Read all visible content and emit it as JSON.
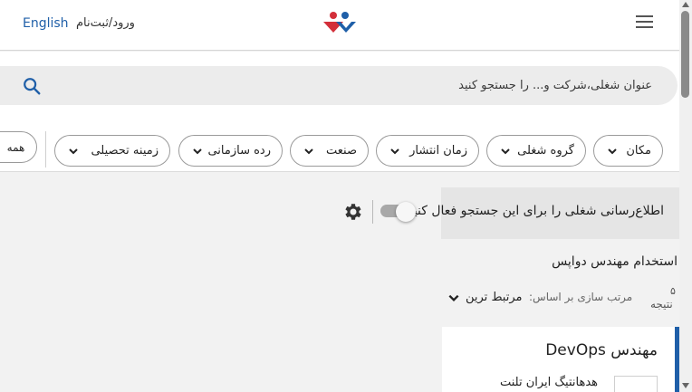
{
  "header": {
    "english_label": "English",
    "login_label": "ورود/ثبت‌نام",
    "logo_icon": "jobinja-logo-icon",
    "menu_icon": "hamburger-menu-icon"
  },
  "search": {
    "placeholder": "عنوان شغلی،شرکت و... را جستجو کنید",
    "icon": "search-icon"
  },
  "filters": {
    "all_label": "همه",
    "chips": [
      "مکان",
      "گروه شغلی",
      "زمان انتشار",
      "صنعت",
      "رده سازمانی",
      "زمینه تحصیلی"
    ]
  },
  "alert": {
    "text": "اطلاع‌رسانی شغلی را برای این جستجو فعال کنید",
    "toggle_on": false,
    "settings_icon": "gear-icon"
  },
  "results": {
    "title": "استخدام مهندس دواپس",
    "count": "۵",
    "count_label": "نتیجه",
    "sort_label": "مرتب سازی بر اساس:",
    "sort_value": "مرتبط ترین"
  },
  "jobs": [
    {
      "title": "مهندس DevOps",
      "company": "هدهانتیگ ایران تلنت"
    }
  ],
  "colors": {
    "accent": "#1f5fa8",
    "logo_red": "#d32f3a",
    "logo_blue": "#1f5fa8"
  }
}
